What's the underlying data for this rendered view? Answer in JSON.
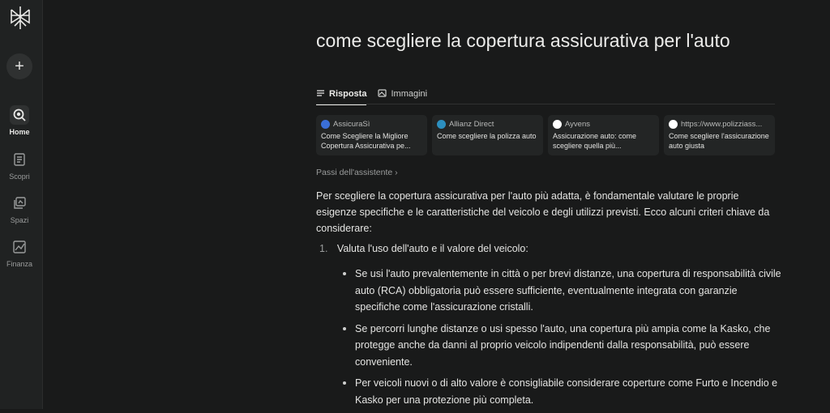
{
  "sidebar": {
    "new_label": "+",
    "items": [
      {
        "label": "Home",
        "icon": "home-icon",
        "active": true
      },
      {
        "label": "Scopri",
        "icon": "discover-icon"
      },
      {
        "label": "Spazi",
        "icon": "spaces-icon"
      },
      {
        "label": "Finanza",
        "icon": "finance-icon"
      }
    ]
  },
  "page": {
    "title": "come scegliere la copertura assicurativa per l'auto",
    "tabs": [
      {
        "label": "Risposta",
        "icon": "list-icon",
        "active": true
      },
      {
        "label": "Immagini",
        "icon": "image-icon"
      }
    ]
  },
  "sources": [
    {
      "name": "AssicuraSì",
      "text": "Come Scegliere la Migliore Copertura Assicurativa pe...",
      "color": "#3a6fd8"
    },
    {
      "name": "Allianz Direct",
      "text": "Come scegliere la polizza auto",
      "color": "#2c8fbf"
    },
    {
      "name": "Ayvens",
      "text": "Assicurazione auto: come scegliere quella più...",
      "color": "#ffffff"
    },
    {
      "name": "https://www.polizziass...",
      "text": "Come scegliere l'assicurazione auto giusta",
      "color": "#ffffff"
    }
  ],
  "steps_label": "Passi dell'assistente",
  "answer": {
    "intro": "Per scegliere la copertura assicurativa per l'auto più adatta, è fondamentale valutare le proprie esigenze specifiche e le caratteristiche del veicolo e degli utilizzi previsti. Ecco alcuni criteri chiave da considerare:",
    "item1_num": "1.",
    "item1_title": "Valuta l'uso dell'auto e il valore del veicolo:",
    "bullets": [
      "Se usi l'auto prevalentemente in città o per brevi distanze, una copertura di responsabilità civile auto (RCA) obbligatoria può essere sufficiente, eventualmente integrata con garanzie specifiche come l'assicurazione cristalli.",
      "Se percorri lunghe distanze o usi spesso l'auto, una copertura più ampia come la Kasko, che protegge anche da danni al proprio veicolo indipendenti dalla responsabilità, può essere conveniente.",
      "Per veicoli nuovi o di alto valore è consigliabile considerare coperture come Furto e Incendio e Kasko per una protezione più completa."
    ]
  }
}
